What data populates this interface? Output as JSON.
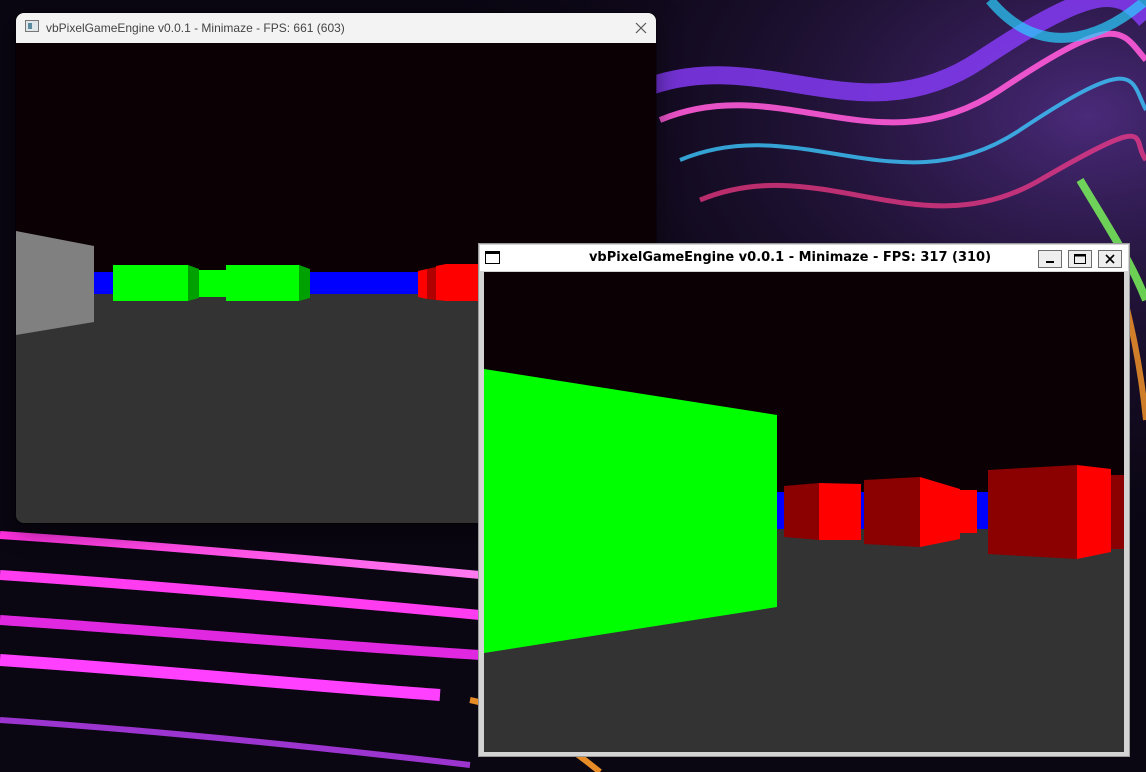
{
  "windows": [
    {
      "title": "vbPixelGameEngine v0.0.1 - Minimaze - FPS: 661 (603)",
      "controls": {
        "close_icon": "close-icon"
      },
      "scene": {
        "ceiling_color": "#0b0104",
        "floor_color": "#333333",
        "wall_colors": [
          "#808080",
          "#00ff00",
          "#0000ff",
          "#ff0000"
        ]
      }
    },
    {
      "title": "vbPixelGameEngine v0.0.1 - Minimaze - FPS: 317 (310)",
      "controls": {
        "minimize_icon": "minimize-icon",
        "maximize_icon": "maximize-icon",
        "close_icon": "close-icon"
      },
      "scene": {
        "ceiling_color": "#0b0104",
        "floor_color": "#333333",
        "wall_colors": [
          "#00ff00",
          "#0000ff",
          "#ff0000",
          "#800000"
        ]
      }
    }
  ],
  "desktop": {
    "wallpaper": "abstract-neon-waves"
  }
}
